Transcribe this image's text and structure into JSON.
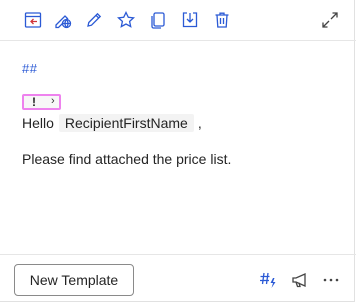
{
  "colors": {
    "accent": "#2b5ad5",
    "chip_border": "#ee82ee",
    "text": "#242424"
  },
  "toolbar": {
    "icons": [
      "insert-template-icon",
      "web-pencil-icon",
      "edit-icon",
      "favorite-star-icon",
      "copy-icon",
      "save-download-icon",
      "delete-icon",
      "expand-icon"
    ]
  },
  "editor": {
    "hash_text": "##",
    "chip": {
      "bang": "!",
      "chevron": "›"
    },
    "hello_prefix": "Hello",
    "field_name": "RecipientFirstName",
    "hello_suffix": ",",
    "paragraph": "Please find attached the price list."
  },
  "footer": {
    "new_template_label": "New Template",
    "icons": [
      "macro-hash-icon",
      "announcement-icon",
      "more-options-icon"
    ]
  }
}
